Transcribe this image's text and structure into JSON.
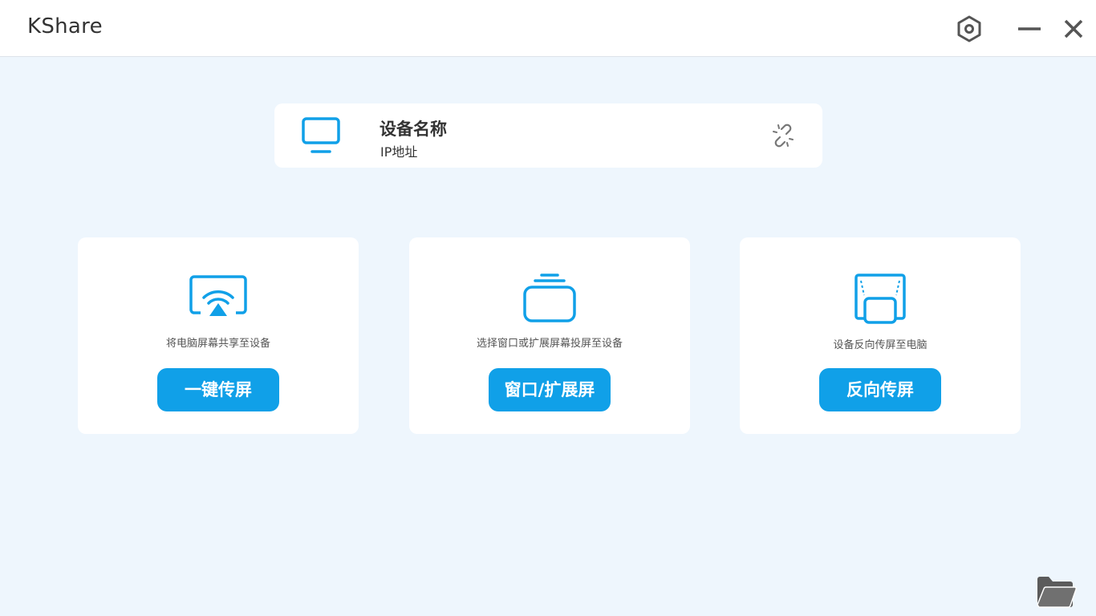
{
  "titlebar": {
    "app_title": "KShare",
    "settings_icon": "settings-hexagon-icon",
    "minimize_icon": "minimize-icon",
    "close_icon": "close-icon"
  },
  "device": {
    "name": "设备名称",
    "ip": "IP地址",
    "device_icon": "monitor-icon",
    "action_icon": "unlink-icon"
  },
  "cards": [
    {
      "icon": "screen-cast-icon",
      "description": "将电脑屏幕共享至设备",
      "button_label": "一键传屏"
    },
    {
      "icon": "window-stack-icon",
      "description": "选择窗口或扩展屏幕投屏至设备",
      "button_label": "窗口/扩展屏"
    },
    {
      "icon": "reverse-cast-icon",
      "description": "设备反向传屏至电脑",
      "button_label": "反向传屏"
    }
  ],
  "footer": {
    "folder_icon": "folder-icon"
  },
  "colors": {
    "accent": "#10a0e8",
    "background": "#eef6fd",
    "card": "#ffffff",
    "text": "#333333",
    "icon_gray": "#555555"
  }
}
